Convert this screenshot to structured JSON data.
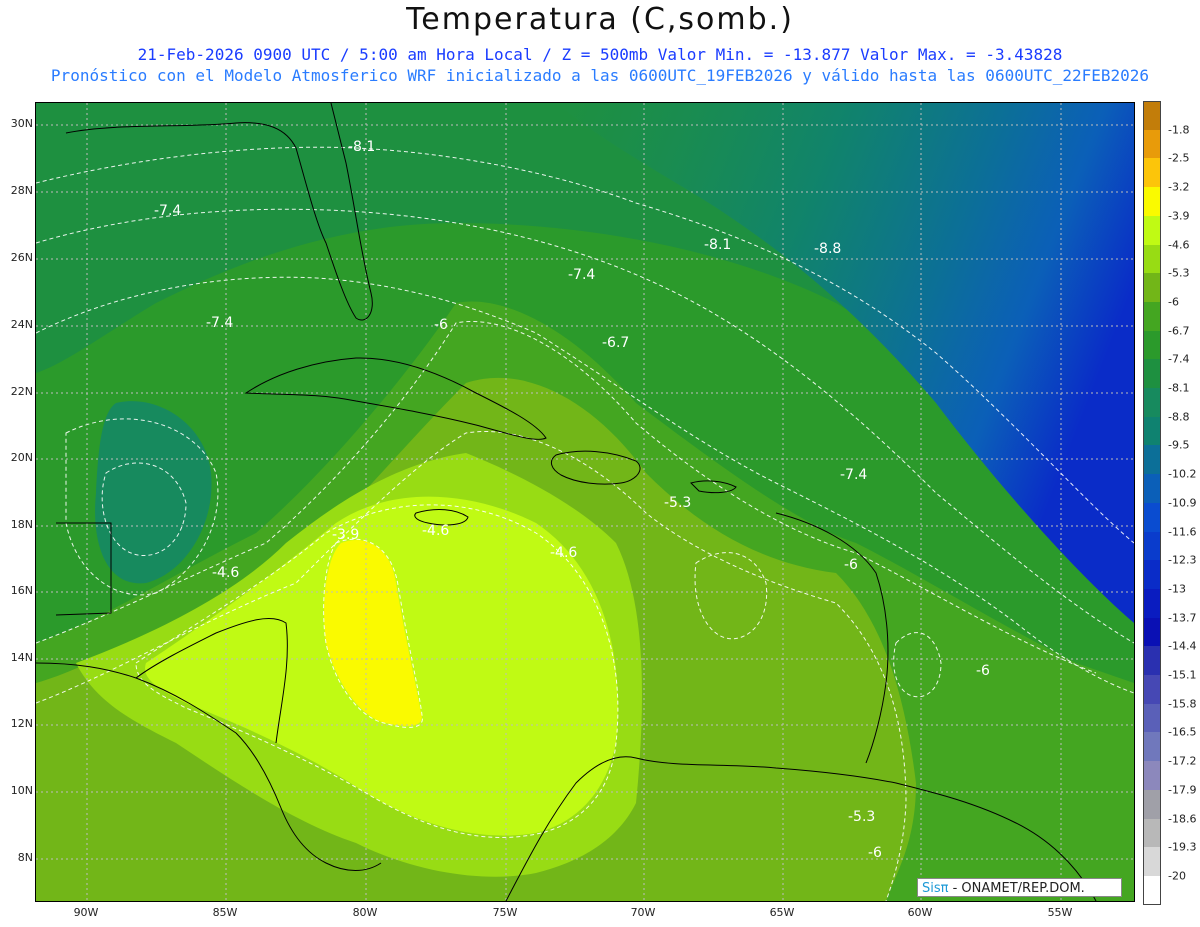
{
  "header": {
    "title": "Temperatura (C,somb.)",
    "subtitle_line1": "21-Feb-2026  0900 UTC / 5:00 am Hora Local / Z = 500mb  Valor Min. = -13.877  Valor Max. = -3.43828",
    "subtitle_line2": "Pronóstico con el Modelo Atmosferico WRF inicializado a las 0600UTC_19FEB2026 y válido hasta las  0600UTC_22FEB2026"
  },
  "axes": {
    "latitude_labels": [
      "30N",
      "28N",
      "26N",
      "24N",
      "22N",
      "20N",
      "18N",
      "16N",
      "14N",
      "12N",
      "10N",
      "8N"
    ],
    "longitude_labels": [
      "90W",
      "85W",
      "80W",
      "75W",
      "70W",
      "65W",
      "60W",
      "55W"
    ]
  },
  "colorbar": {
    "labels": [
      "-1.8",
      "-2.5",
      "-3.2",
      "-3.9",
      "-4.6",
      "-5.3",
      "-6",
      "-6.7",
      "-7.4",
      "-8.1",
      "-8.8",
      "-9.5",
      "-10.2",
      "-10.9",
      "-11.6",
      "-12.3",
      "-13",
      "-13.7",
      "-14.4",
      "-15.1",
      "-15.8",
      "-16.5",
      "-17.2",
      "-17.9",
      "-18.6",
      "-19.3",
      "-20"
    ],
    "colors": [
      "#c27d0a",
      "#e89b0a",
      "#fcc50a",
      "#fafa00",
      "#c0fa14",
      "#98dc14",
      "#72b618",
      "#44a621",
      "#2b9a2b",
      "#1e9040",
      "#178a5e",
      "#0f8270",
      "#0c6f98",
      "#0b5fb8",
      "#0a4cd0",
      "#0a3ccc",
      "#0a2cc8",
      "#0a1cc0",
      "#0a10b4",
      "#2a30b0",
      "#4648b4",
      "#5a60b8",
      "#7078bc",
      "#8c88bc",
      "#a0a0a8",
      "#b8b8b8",
      "#d8d8d8",
      "#ffffff"
    ]
  },
  "contour_labels": [
    "-8.1",
    "-7.4",
    "-7.4",
    "-8.1",
    "-8.8",
    "-7.4",
    "-6",
    "-6.7",
    "-3.9",
    "-4.6",
    "-4.6",
    "-4.6",
    "-5.3",
    "-6",
    "-7.4",
    "-6",
    "-5.3",
    "-6"
  ],
  "credit": {
    "logo": "Sisπ",
    "org": " - ONAMET/REP.DOM."
  }
}
